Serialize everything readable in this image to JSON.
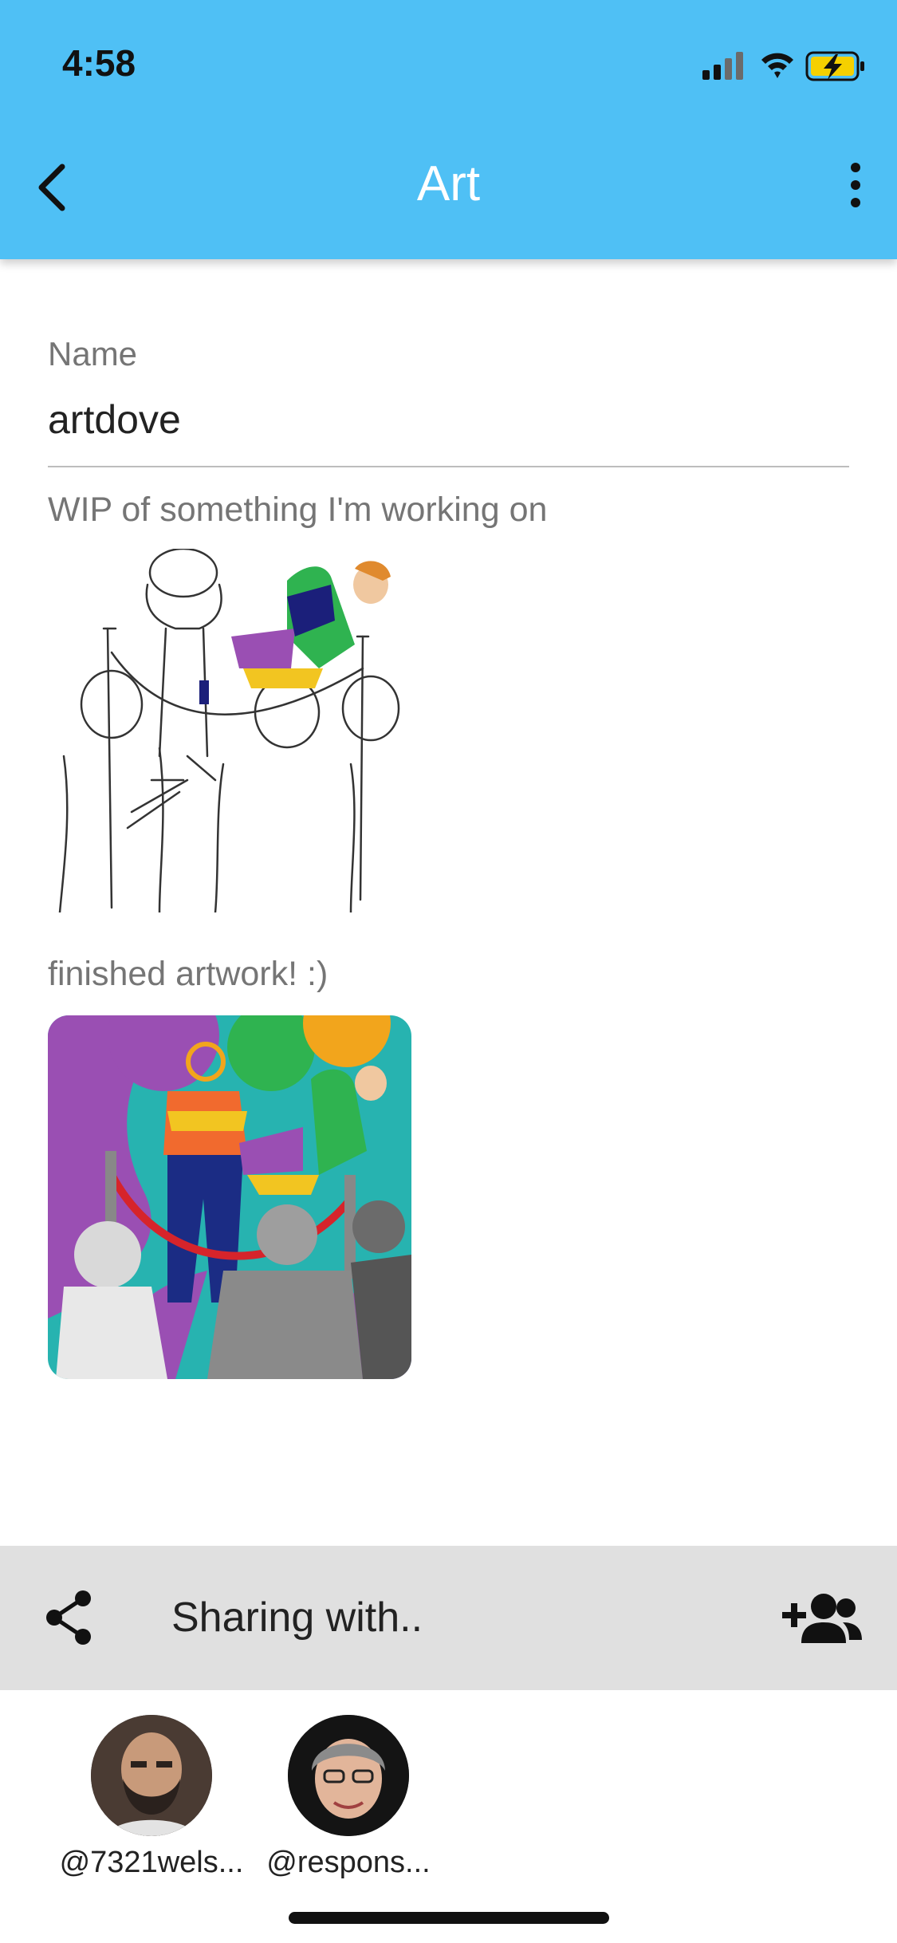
{
  "status_bar": {
    "time": "4:58"
  },
  "app_bar": {
    "title": "Art"
  },
  "form": {
    "name_label": "Name",
    "name_value": "artdove"
  },
  "posts": [
    {
      "caption": "WIP of something I'm working on",
      "image_icon": "sketch-artwork"
    },
    {
      "caption": "finished artwork! :)",
      "image_icon": "colored-artwork"
    }
  ],
  "sharing": {
    "label": "Sharing with..",
    "users": [
      {
        "handle": "@7321wels..."
      },
      {
        "handle": "@respons..."
      }
    ]
  },
  "colors": {
    "app_bar": "#4fc0f5",
    "share_bar": "#e0e0e0",
    "accent_purple": "#9a4fb3",
    "accent_teal": "#27b3b0"
  }
}
